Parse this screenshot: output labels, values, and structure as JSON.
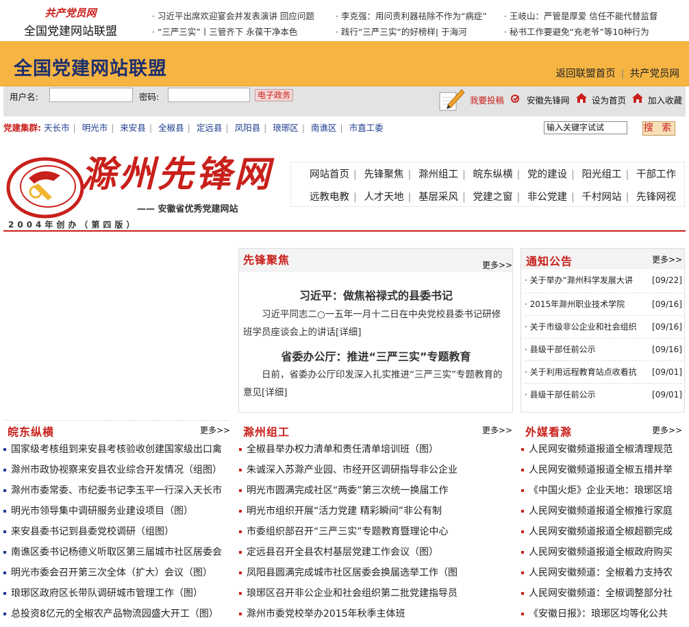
{
  "top": {
    "logo_line1": "共产党员网",
    "logo_line2": "全国党建网站联盟",
    "news": [
      "习近平出席欢迎宴会并发表演讲  回应问题",
      "李克强：用问责利器祛除不作为“病症”",
      "王岐山：严管是厚爱 信任不能代替监督",
      "“三严三实”丨三管齐下 永葆干净本色",
      "践行“三严三实”的好榜样| 于海河",
      "秘书工作要避免“充老爷”等10种行为"
    ]
  },
  "banner": {
    "title": "全国党建网站联盟",
    "link_back": "返回联盟首页",
    "link_member": "共产党员网"
  },
  "login": {
    "username_label": "用户名:",
    "password_label": "密码:",
    "egov_label": "电子政务",
    "submit_label": "我要投稿",
    "anhui_label": "安徽先锋网",
    "home_label": "设为首页",
    "fav_label": "加入收藏"
  },
  "districts": {
    "heading": "党建集群:",
    "items": [
      "天长市",
      "明光市",
      "来安县",
      "全椒县",
      "定远县",
      "凤阳县",
      "琅琊区",
      "南谯区",
      "市直工委"
    ]
  },
  "search": {
    "value": "输入关键字试试",
    "button": "搜 索"
  },
  "logo": {
    "name": "滁州先锋网",
    "subtitle": "—— 安徽省优秀党建网站",
    "founded": "2004年创办（第四版）"
  },
  "nav": {
    "row1": [
      "网站首页",
      "先锋聚焦",
      "滁州组工",
      "皖东纵横",
      "党的建设",
      "阳光组工",
      "干部工作"
    ],
    "row2": [
      "远教电教",
      "人才天地",
      "基层采风",
      "党建之窗",
      "非公党建",
      "千村网站",
      "先锋网视"
    ]
  },
  "focus": {
    "title": "先锋聚焦",
    "more": "更多>>",
    "headline1": "习近平：做焦裕禄式的县委书记",
    "body1": "习近平同志二○一五年一月十二日在中央党校县委书记研修班学员座谈会上的讲话[详细]",
    "headline2": "省委办公厅：推进“三严三实”专题教育",
    "body2": "日前，省委办公厅印发深入扎实推进“三严三实”专题教育的意见[详细]"
  },
  "notice": {
    "title": "通知公告",
    "more": "更多>>",
    "items": [
      {
        "text": "关于举办“滁州科学发展大讲",
        "date": "[09/22]"
      },
      {
        "text": "2015年滁州职业技术学院",
        "date": "[09/16]"
      },
      {
        "text": "关于市级非公企业和社会组织",
        "date": "[09/16]"
      },
      {
        "text": "县级干部任前公示",
        "date": "[09/16]"
      },
      {
        "text": "关于利用远程教育站点收看抗",
        "date": "[09/01]"
      },
      {
        "text": "县级干部任前公示",
        "date": "[09/01]"
      }
    ]
  },
  "wandong": {
    "title": "皖东纵横",
    "more": "更多>>",
    "items": [
      "国家级考核组到来安县考核验收创建国家级出口禽",
      "滁州市政协视察来安县农业综合开发情况（组图）",
      "滁州市委常委、市纪委书记李玉平一行深入天长市",
      "明光市领导集中调研服务业建设项目（图）",
      "来安县委书记到县委党校调研（组图）",
      "南谯区委书记杨德义听取区第三届城市社区居委会",
      "明光市委会召开第三次全体（扩大）会议（图）",
      "琅琊区政府区长带队调研城市管理工作（图）",
      "总投资8亿元的全椒农产品物流园盛大开工（图）"
    ]
  },
  "zugong": {
    "title": "滁州组工",
    "more": "更多>>",
    "items": [
      "全椒县举办权力清单和责任清单培训班（图）",
      "朱诚深入苏滁产业园、市经开区调研指导非公企业",
      "明光市圆满完成社区“两委”第三次统一换届工作",
      "明光市组织开展“活力党建 精彩瞬间”非公有制",
      "市委组织部召开“三严三实”专题教育暨理论中心",
      "定远县召开全县农村基层党建工作会议（图）",
      "凤阳县圆满完成城市社区居委会换届选举工作（图",
      "琅琊区召开非公企业和社会组织第二批党建指导员",
      "滁州市委党校举办2015年秋季主体班"
    ]
  },
  "media": {
    "title": "外媒看滁",
    "more": "更多>>",
    "items": [
      "人民网安徽频道报道全椒清理规范",
      "人民网安徽频道报道全椒五措并举",
      "《中国火炬》企业天地：琅琊区培",
      "人民网安徽频道报道全椒推行家庭",
      "人民网安徽频道报道全椒超额完成",
      "人民网安徽频道报道全椒政府购买",
      "人民网安徽频道：全椒着力支持农",
      "人民网安徽频道：全椒调整部分社",
      "《安徽日报》：琅琊区均等化公共"
    ]
  },
  "colors": {
    "accent": "#c8201b",
    "banner": "#f6b442",
    "navy": "#1d2f6e"
  }
}
